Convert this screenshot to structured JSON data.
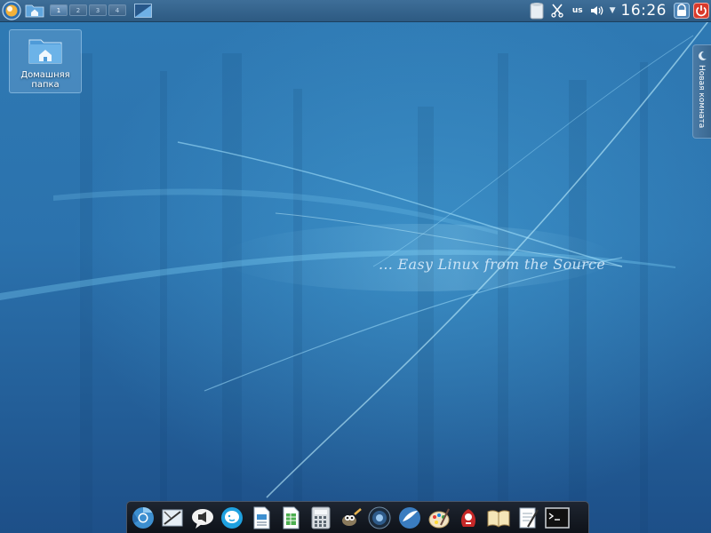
{
  "wallpaper": {
    "tagline": "... Easy Linux from the Source"
  },
  "top_panel": {
    "pager_desktops": [
      "1",
      "2",
      "3",
      "4"
    ],
    "active_desktop_index": 0,
    "keyboard_layout": "us",
    "clock": "16:26"
  },
  "desktop_icons": [
    {
      "label": "Домашняя папка",
      "icon": "home-folder-icon"
    }
  ],
  "activity_tab": {
    "label": "Новая комната"
  },
  "dock": {
    "items": [
      "chromium-icon",
      "screenshot-tool-icon",
      "messenger-icon",
      "skype-icon",
      "text-document-icon",
      "spreadsheet-icon",
      "calculator-icon",
      "gimp-icon",
      "media-player-icon",
      "ship-app-icon",
      "paint-app-icon",
      "game-icon",
      "ebook-reader-icon",
      "notes-icon",
      "terminal-icon"
    ]
  },
  "colors": {
    "accent": "#3d8fd0",
    "power": "#d93a2b"
  }
}
